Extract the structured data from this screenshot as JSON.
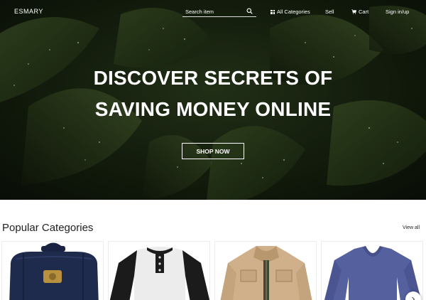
{
  "brand": {
    "logo_text": "ESMARY"
  },
  "search": {
    "placeholder": "Search item",
    "icon": "search-icon"
  },
  "nav": {
    "categories_label": "All Categories",
    "sell_label": "Sell",
    "cart_label": "Cart",
    "sign_label": "Sign in/up"
  },
  "hero": {
    "title_line1": "DISCOVER SECRETS OF",
    "title_line2": "SAVING MONEY ONLINE",
    "cta_label": "SHOP NOW"
  },
  "categories": {
    "title": "Popular Categories",
    "view_all_label": "View all",
    "items": [
      {
        "image": "navy-backpack",
        "color": "#1e2a4a"
      },
      {
        "image": "raglan-henley-shirt",
        "color": "#e8e8e8"
      },
      {
        "image": "tan-jacket",
        "color": "#cdb596"
      },
      {
        "image": "blue-v-neck-sweater",
        "color": "#54609e"
      }
    ]
  },
  "colors": {
    "hero_dark": "#17220f",
    "text_light": "#ffffff",
    "text_dark": "#222222"
  }
}
